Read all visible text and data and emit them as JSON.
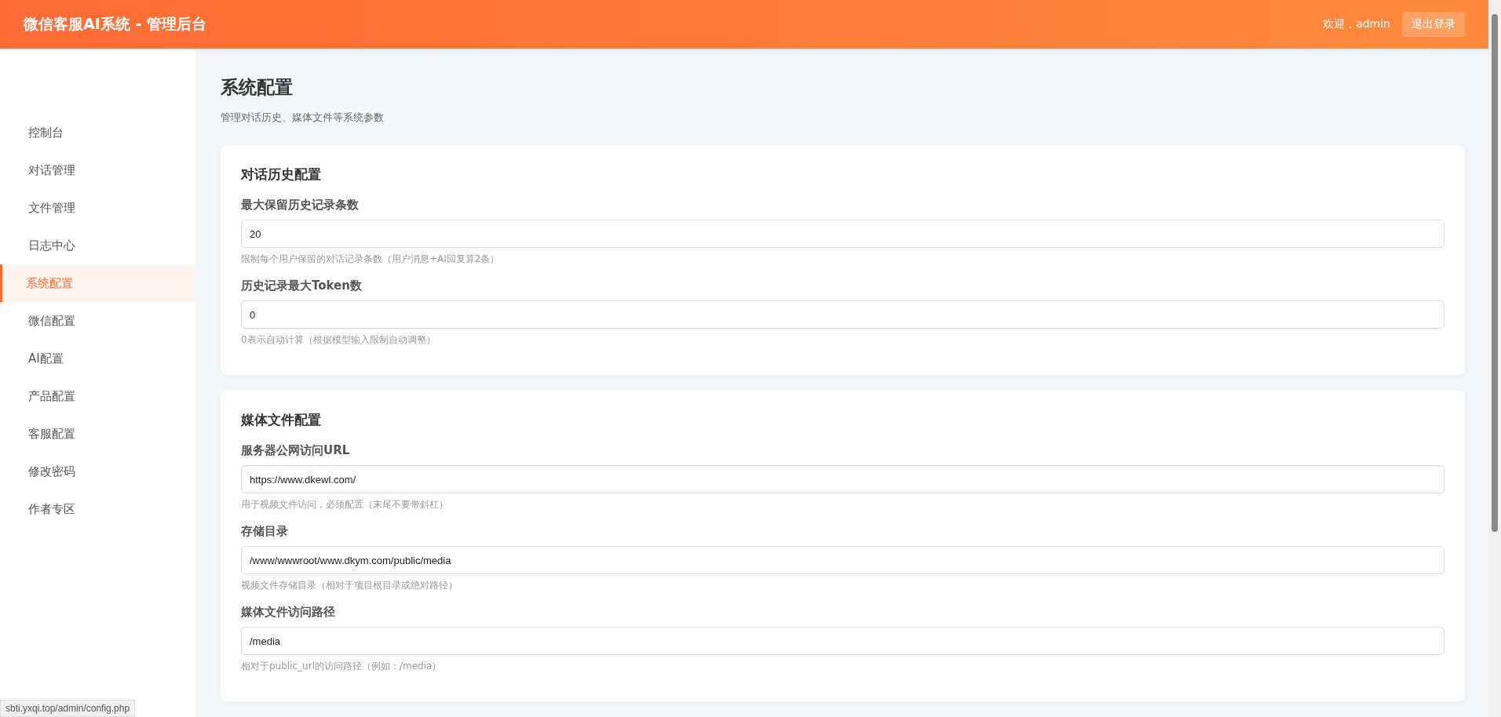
{
  "header": {
    "title": "微信客服AI系统 - 管理后台",
    "welcome": "欢迎，admin",
    "logout_button": "退出登录"
  },
  "sidebar": {
    "items": [
      {
        "label": "控制台",
        "selected": false
      },
      {
        "label": "对话管理",
        "selected": false
      },
      {
        "label": "文件管理",
        "selected": false
      },
      {
        "label": "日志中心",
        "selected": false
      },
      {
        "label": "系统配置",
        "selected": true
      },
      {
        "label": "微信配置",
        "selected": false
      },
      {
        "label": "AI配置",
        "selected": false
      },
      {
        "label": "产品配置",
        "selected": false
      },
      {
        "label": "客服配置",
        "selected": false
      },
      {
        "label": "修改密码",
        "selected": false
      },
      {
        "label": "作者专区",
        "selected": false
      }
    ]
  },
  "page": {
    "title": "系统配置",
    "subtitle": "管理对话历史、媒体文件等系统参数"
  },
  "sections": [
    {
      "title": "对话历史配置",
      "fields": [
        {
          "label": "最大保留历史记录条数",
          "value": "20",
          "hint": "限制每个用户保留的对话记录条数（用户消息+AI回复算2条）"
        },
        {
          "label": "历史记录最大Token数",
          "value": "0",
          "hint": "0表示自动计算（根据模型输入限制自动调整）"
        }
      ]
    },
    {
      "title": "媒体文件配置",
      "fields": [
        {
          "label": "服务器公网访问URL",
          "value": "https://www.dkewl.com/",
          "hint": "用于视频文件访问，必须配置（末尾不要带斜杠）"
        },
        {
          "label": "存储目录",
          "value": "/www/wwwroot/www.dkym.com/public/media",
          "hint": "视频文件存储目录（相对于项目根目录或绝对路径）"
        },
        {
          "label": "媒体文件访问路径",
          "value": "/media",
          "hint": "相对于public_url的访问路径（例如：/media）"
        }
      ]
    }
  ],
  "status_bar": "sbti.yxqi.top/admin/config.php"
}
